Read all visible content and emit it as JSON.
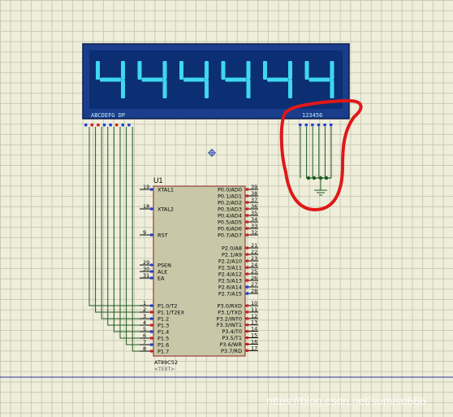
{
  "display": {
    "digits": [
      "4",
      "4",
      "4",
      "4",
      "4",
      "4"
    ],
    "segments_label": "ABCDEFG DP",
    "digit_select_label": "123456",
    "color_bg": "#1a3d8c",
    "color_panel": "#0c2f73",
    "color_segment": "#3ed8f0"
  },
  "chip": {
    "ref": "U1",
    "part": "AT89C52",
    "text_placeholder": "<TEXT>",
    "left_pins": [
      {
        "num": "19",
        "name": "XTAL1"
      },
      {
        "num": "18",
        "name": "XTAL2"
      },
      {
        "num": "9",
        "name": "RST"
      },
      {
        "num": "29",
        "name": "PSEN"
      },
      {
        "num": "30",
        "name": "ALE"
      },
      {
        "num": "31",
        "name": "EA"
      },
      {
        "num": "1",
        "name": "P1.0/T2"
      },
      {
        "num": "2",
        "name": "P1.1/T2EX"
      },
      {
        "num": "3",
        "name": "P1.2"
      },
      {
        "num": "4",
        "name": "P1.3"
      },
      {
        "num": "5",
        "name": "P1.4"
      },
      {
        "num": "6",
        "name": "P1.5"
      },
      {
        "num": "7",
        "name": "P1.6"
      },
      {
        "num": "8",
        "name": "P1.7"
      }
    ],
    "right_pins": [
      {
        "num": "39",
        "name": "P0.0/AD0"
      },
      {
        "num": "38",
        "name": "P0.1/AD1"
      },
      {
        "num": "37",
        "name": "P0.2/AD2"
      },
      {
        "num": "36",
        "name": "P0.3/AD3"
      },
      {
        "num": "35",
        "name": "P0.4/AD4"
      },
      {
        "num": "34",
        "name": "P0.5/AD5"
      },
      {
        "num": "33",
        "name": "P0.6/AD6"
      },
      {
        "num": "32",
        "name": "P0.7/AD7"
      },
      {
        "num": "21",
        "name": "P2.0/A8"
      },
      {
        "num": "22",
        "name": "P2.1/A9"
      },
      {
        "num": "23",
        "name": "P2.2/A10"
      },
      {
        "num": "24",
        "name": "P2.3/A11"
      },
      {
        "num": "25",
        "name": "P2.4/A12"
      },
      {
        "num": "26",
        "name": "P2.5/A13"
      },
      {
        "num": "27",
        "name": "P2.6/A14"
      },
      {
        "num": "28",
        "name": "P2.7/A15"
      },
      {
        "num": "10",
        "name": "P3.0/RXD"
      },
      {
        "num": "11",
        "name": "P3.1/TXD"
      },
      {
        "num": "12",
        "name": "P3.2/INT0"
      },
      {
        "num": "13",
        "name": "P3.3/INT1"
      },
      {
        "num": "14",
        "name": "P3.4/T0"
      },
      {
        "num": "15",
        "name": "P3.5/T1"
      },
      {
        "num": "16",
        "name": "P3.6/WR"
      },
      {
        "num": "17",
        "name": "P3.7/RD"
      }
    ]
  },
  "watermark": "https://blog.csdn.net/sumisu666",
  "colors": {
    "wire": "#1f5a1f",
    "annotation": "#e01818",
    "chip_fill": "#c8c8a8",
    "chip_border": "#8a2020"
  }
}
